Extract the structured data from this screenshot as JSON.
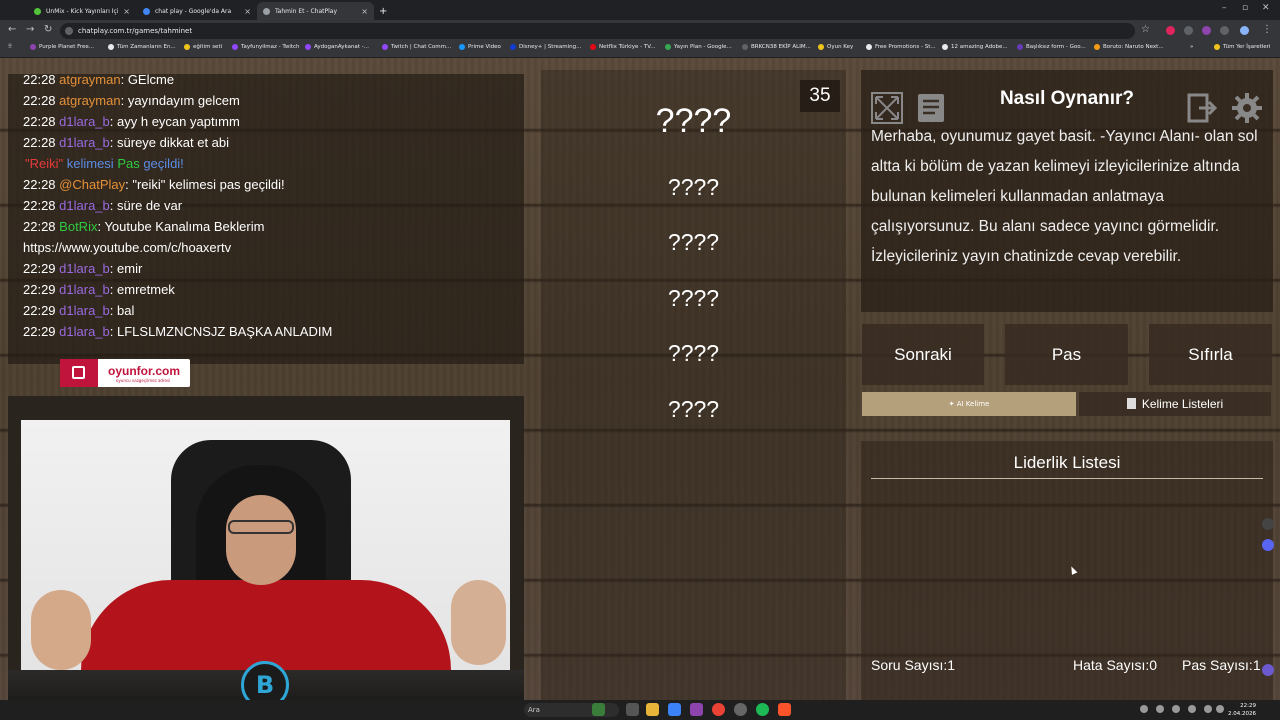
{
  "browser": {
    "tabs": [
      {
        "title": "UnMix - Kick Yayınları İçin Kelim",
        "active": false,
        "icon_color": "#53c23b"
      },
      {
        "title": "chat play - Google'da Ara",
        "active": false,
        "icon_color": "#4285f4"
      },
      {
        "title": "Tahmin Et - ChatPlay",
        "active": true,
        "icon_color": "#9aa0a6"
      }
    ],
    "new_tab": "+",
    "address": "chatplay.com.tr/games/tahminet",
    "bookmarks": [
      "Purple Planet Free...",
      "Tüm Zamanların En...",
      "eğitim seti",
      "Tayfunyilmaz - Twitch",
      "AydoganAykanat -...",
      "Twitch | Chat Comm...",
      "Prime Video",
      "Disney+ | Streaming...",
      "Netflix Türkiye - TV...",
      "Yayın Plan - Google...",
      "BRKCN38 EKİP ALIM...",
      "Oyun Key",
      "Free Promotions - St...",
      "12 amazing Adobe...",
      "Başlıksız form - Goo...",
      "Boruto: Naruto Next...",
      "Tüm Yer İşaretleri"
    ]
  },
  "chat": {
    "messages": [
      {
        "time": "22:28",
        "user": "atgrayman",
        "user_color": "orange",
        "text": ": GElcme"
      },
      {
        "time": "22:28",
        "user": "atgrayman",
        "user_color": "orange",
        "text": ": yayındayım gelcem"
      },
      {
        "time": "22:28",
        "user": "d1lara_b",
        "user_color": "purple",
        "text": ": ayy h eycan yaptımm"
      },
      {
        "time": "22:28",
        "user": "d1lara_b",
        "user_color": "purple",
        "text": ": süreye dikkat et abi"
      },
      {
        "system": true,
        "part1": "\"Reiki\"",
        "part2": " kelimesi ",
        "part3": "Pas",
        "part4": " geçildi!"
      },
      {
        "time": "22:28",
        "user": "@ChatPlay",
        "user_color": "orange",
        "text": ": \"reiki\" kelimesi pas geçildi!"
      },
      {
        "time": "22:28",
        "user": "d1lara_b",
        "user_color": "purple",
        "text": ": süre de var"
      },
      {
        "time": "22:28",
        "user": "BotRix",
        "user_color": "green",
        "text": ": Youtube Kanalıma Beklerim"
      },
      {
        "plain": "https://www.youtube.com/c/hoaxertv"
      },
      {
        "time": "22:29",
        "user": "d1lara_b",
        "user_color": "purple",
        "text": ": emir"
      },
      {
        "time": "22:29",
        "user": "d1lara_b",
        "user_color": "purple",
        "text": ": emretmek"
      },
      {
        "time": "22:29",
        "user": "d1lara_b",
        "user_color": "purple",
        "text": ": bal"
      },
      {
        "time": "22:29",
        "user": "d1lara_b",
        "user_color": "purple",
        "text": ": LFLSLMZNCNSJZ BAŞKA ANLADIM"
      }
    ]
  },
  "sponsor": {
    "name": "oyunfor.com",
    "tagline": "oyuncu vazgeçilmez adresi"
  },
  "stream_logo": "B",
  "game": {
    "timer": "35",
    "main_word": "????",
    "hidden_words": [
      "????",
      "????",
      "????",
      "????",
      "????"
    ]
  },
  "howto": {
    "title": "Nasıl Oynanır?",
    "body": "Merhaba, oyunumuz gayet basit. -Yayıncı Alanı- olan sol altta ki bölüm de yazan kelimeyi izleyicilerinize altında bulunan kelimeleri kullanmadan anlatmaya çalışıyorsunuz. Bu alanı sadece yayıncı görmelidir. İzleyicileriniz yayın chatinizde cevap verebilir."
  },
  "controls": {
    "next": "Sonraki",
    "pass": "Pas",
    "reset": "Sıfırla",
    "ai_word": "AI Kelime",
    "word_lists": "Kelime Listeleri"
  },
  "leaderboard": {
    "title": "Liderlik Listesi"
  },
  "stats": {
    "questions_label": "Soru Sayısı:",
    "questions": "1",
    "errors_label": "Hata Sayısı:",
    "errors": "0",
    "passes_label": "Pas Sayısı:",
    "passes": "1"
  },
  "taskbar": {
    "search_placeholder": "Ara",
    "time": "22:29",
    "date": "2.04.2026"
  },
  "colors": {
    "orange": "#e69138",
    "purple": "#9a6ae0",
    "green": "#2ecc40",
    "red": "#e63a3a",
    "blue": "#5b8de6",
    "ai_button": "#b5a07c"
  }
}
